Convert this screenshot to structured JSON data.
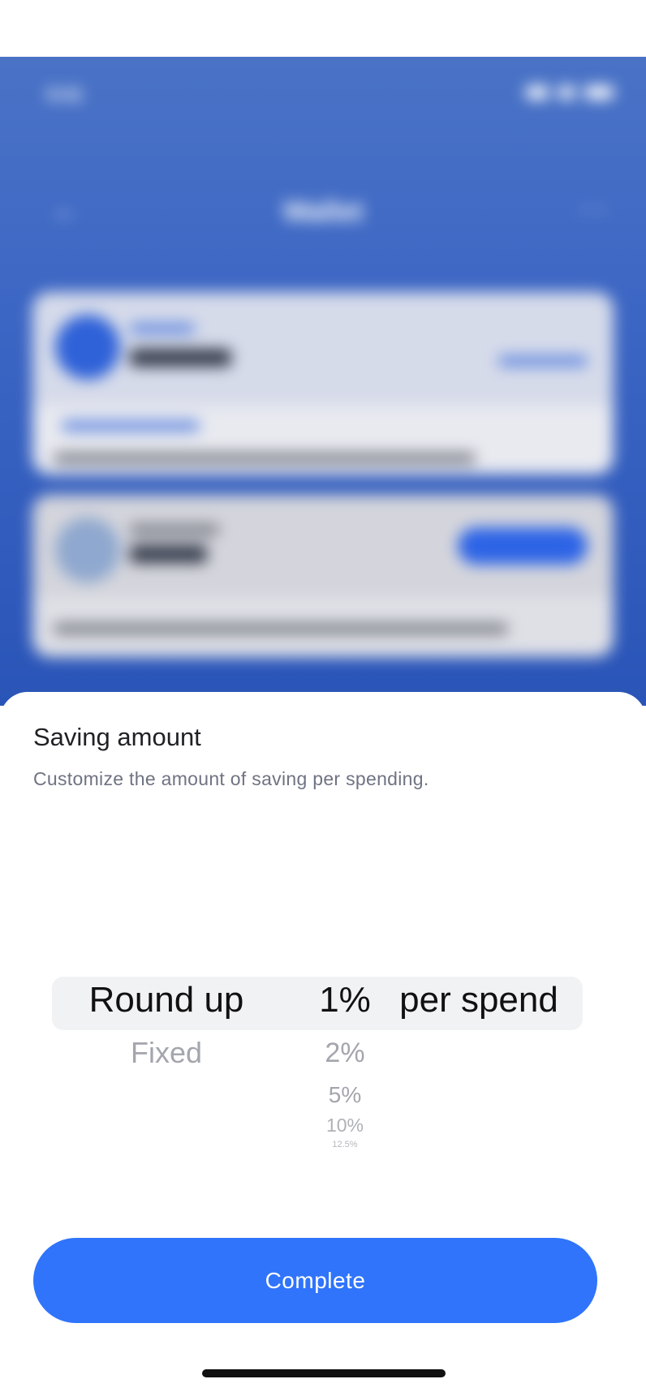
{
  "background_app": {
    "status_time": "9:41",
    "title": "Wallet"
  },
  "sheet": {
    "title": "Saving amount",
    "subtitle": "Customize the amount of saving per spending."
  },
  "picker": {
    "type_options": [
      "Round up",
      "Fixed"
    ],
    "selected_type": "Round up",
    "percent_options": [
      "1%",
      "2%",
      "5%",
      "10%",
      "12.5%"
    ],
    "selected_percent": "1%",
    "unit_label": "per spend"
  },
  "actions": {
    "complete_label": "Complete"
  },
  "colors": {
    "accent": "#2f74fb",
    "background_header": "#3c66c4"
  }
}
